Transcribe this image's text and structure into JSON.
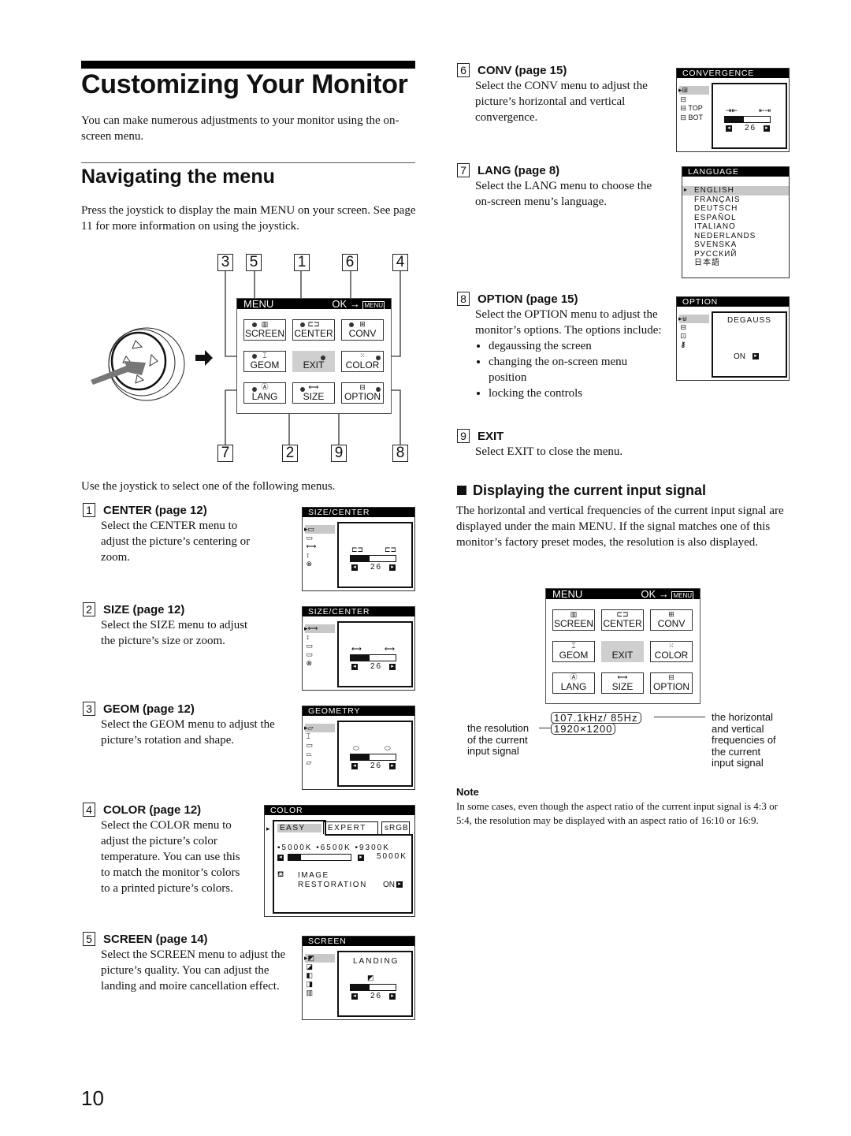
{
  "page": {
    "title": "Customizing Your Monitor",
    "intro": "You can make numerous adjustments to your monitor using the on-screen menu.",
    "section_title": "Navigating the menu",
    "section_intro": "Press the joystick to display the main MENU on your screen. See page 11 for more information on using the joystick.",
    "select_hint": "Use the joystick to select one of the following menus.",
    "page_number": "10"
  },
  "main_menu": {
    "title": "MENU",
    "ok_label": "OK",
    "menu_icon_label": "MENU",
    "buttons": [
      {
        "label": "SCREEN",
        "icon": "screen-icon",
        "glyph": "▥",
        "callout": "5"
      },
      {
        "label": "CENTER",
        "icon": "center-icon",
        "glyph": "⊏⊐",
        "callout": "1"
      },
      {
        "label": "CONV",
        "icon": "conv-icon",
        "glyph": "⊞",
        "callout": "6"
      },
      {
        "label": "GEOM",
        "icon": "geom-icon",
        "glyph": "⌶",
        "callout": "3"
      },
      {
        "label": "EXIT",
        "icon": "",
        "glyph": "",
        "callout": "9"
      },
      {
        "label": "COLOR",
        "icon": "color-icon",
        "glyph": "⁙",
        "callout": "4"
      },
      {
        "label": "LANG",
        "icon": "lang-icon",
        "glyph": "Ⓐ",
        "callout": "7"
      },
      {
        "label": "SIZE",
        "icon": "size-icon",
        "glyph": "⟷",
        "callout": "2"
      },
      {
        "label": "OPTION",
        "icon": "option-icon",
        "glyph": "⊟",
        "callout": "8"
      }
    ],
    "callouts_top": [
      "3",
      "5",
      "1",
      "6",
      "4"
    ],
    "callouts_bottom": [
      "7",
      "2",
      "9",
      "8"
    ]
  },
  "sections": {
    "center": {
      "num": "1",
      "title": "CENTER (page 12)",
      "body": "Select the CENTER menu to adjust the picture’s centering or zoom."
    },
    "size": {
      "num": "2",
      "title": "SIZE (page 12)",
      "body": "Select the SIZE menu to adjust the picture’s size or zoom."
    },
    "geom": {
      "num": "3",
      "title": "GEOM (page 12)",
      "body": "Select the GEOM menu to adjust the picture’s rotation and shape."
    },
    "color": {
      "num": "4",
      "title": "COLOR (page 12)",
      "body": "Select the COLOR menu to adjust the picture’s color temperature. You can use this to match the monitor’s colors to a printed picture’s colors."
    },
    "screen": {
      "num": "5",
      "title": "SCREEN (page 14)",
      "body": "Select the SCREEN menu to adjust the picture’s quality. You can adjust the landing and moire cancellation effect."
    },
    "conv": {
      "num": "6",
      "title": "CONV (page 15)",
      "body": "Select the CONV menu to adjust the picture’s horizontal and vertical convergence."
    },
    "lang": {
      "num": "7",
      "title": "LANG (page 8)",
      "body": "Select the LANG menu to choose the on-screen menu’s language."
    },
    "option": {
      "num": "8",
      "title": "OPTION (page 15)",
      "body": "Select the OPTION menu to adjust the monitor’s options. The options include:",
      "bullets": [
        "degaussing the screen",
        "changing the on-screen menu position",
        "locking the controls"
      ]
    },
    "exit": {
      "num": "9",
      "title": "EXIT",
      "body": "Select EXIT to close the menu."
    }
  },
  "osd": {
    "center": {
      "title": "SIZE/CENTER",
      "value": "26",
      "level": 0.42
    },
    "size": {
      "title": "SIZE/CENTER",
      "value": "26",
      "level": 0.42
    },
    "geom": {
      "title": "GEOMETRY",
      "value": "26",
      "level": 0.42
    },
    "color": {
      "title": "COLOR",
      "tabs": [
        "EASY",
        "EXPERT",
        "sRGB"
      ],
      "presets": [
        "5000K",
        "6500K",
        "9300K"
      ],
      "current": "5000K",
      "level": 0.2,
      "restoration_label_1": "IMAGE",
      "restoration_label_2": "RESTORATION",
      "restoration_value": "ON"
    },
    "screen": {
      "title": "SCREEN",
      "item": "LANDING",
      "value": "26",
      "level": 0.42
    },
    "conv": {
      "title": "CONVERGENCE",
      "top_label": "TOP",
      "bot_label": "BOT",
      "value": "26",
      "level": 0.42
    },
    "lang": {
      "title": "LANGUAGE",
      "items": [
        "ENGLISH",
        "FRANÇAIS",
        "DEUTSCH",
        "ESPAÑOL",
        "ITALIANO",
        "NEDERLANDS",
        "SVENSKA",
        "РУССКИЙ",
        "日本語"
      ]
    },
    "option": {
      "title": "OPTION",
      "item": "DEGAUSS",
      "value": "ON"
    }
  },
  "input_signal": {
    "heading": "Displaying the current input signal",
    "body": "The horizontal and vertical frequencies of the current input signal are displayed under the main MENU. If the signal matches one of this monitor’s factory preset modes, the resolution is also displayed.",
    "frequency": "107.1kHz/  85Hz",
    "resolution": "1920×1200",
    "resolution_caption": [
      "the resolution",
      "of the current",
      "input signal"
    ],
    "frequency_caption": [
      "the horizontal",
      "and vertical",
      "frequencies of",
      "the current",
      "input signal"
    ]
  },
  "note": {
    "title": "Note",
    "body": "In some cases, even though the aspect ratio of the current input signal is 4:3 or 5:4, the resolution may be displayed with an aspect ratio of 16:10 or 16:9."
  }
}
